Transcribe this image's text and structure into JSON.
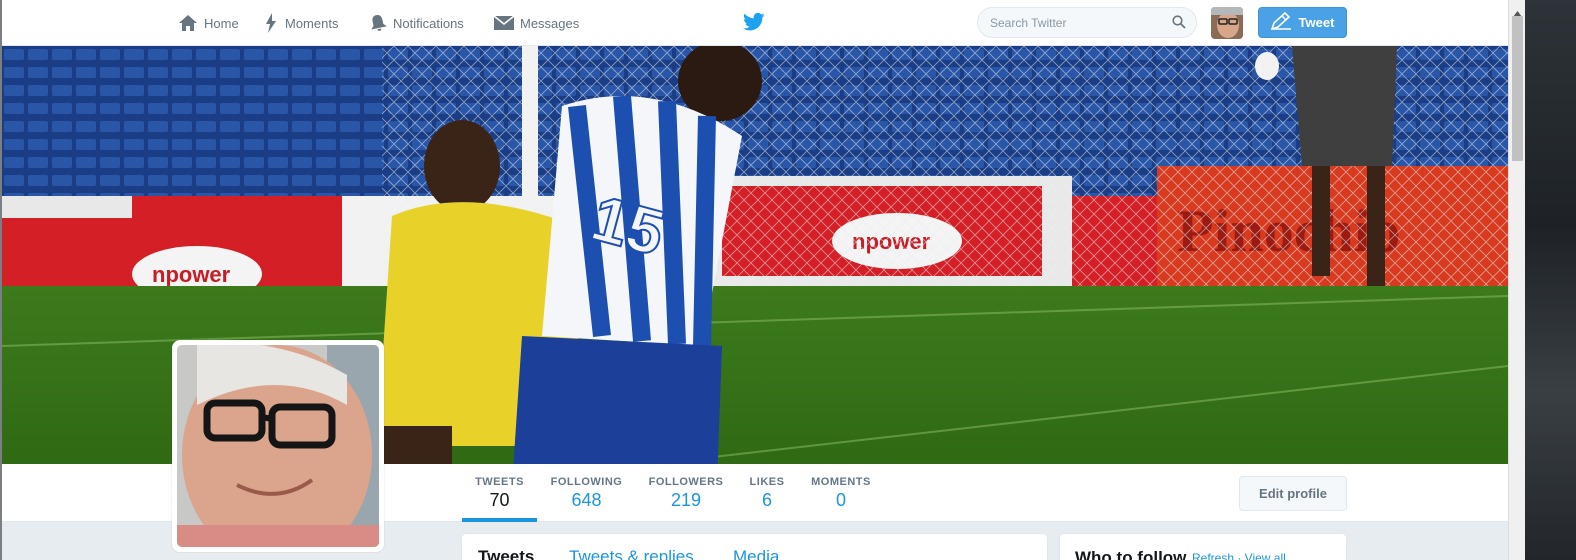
{
  "nav": {
    "home": "Home",
    "moments": "Moments",
    "notifications": "Notifications",
    "messages": "Messages",
    "search_placeholder": "Search Twitter",
    "tweet_button": "Tweet"
  },
  "profile_stats": [
    {
      "label": "TWEETS",
      "value": "70"
    },
    {
      "label": "FOLLOWING",
      "value": "648"
    },
    {
      "label": "FOLLOWERS",
      "value": "219"
    },
    {
      "label": "LIKES",
      "value": "6"
    },
    {
      "label": "MOMENTS",
      "value": "0"
    }
  ],
  "edit_profile": "Edit profile",
  "tweet_tabs": [
    "Tweets",
    "Tweets & replies",
    "Media"
  ],
  "who_to_follow": {
    "title": "Who to follow",
    "links": "Refresh · View all"
  },
  "colors": {
    "accent": "#1b95e0",
    "tweet_button": "#4aa1e6",
    "twitter_blue": "#1da1f2"
  },
  "icons": [
    "home-icon",
    "lightning-icon",
    "bell-icon",
    "envelope-icon",
    "twitter-bird-icon",
    "search-icon",
    "compose-icon"
  ]
}
